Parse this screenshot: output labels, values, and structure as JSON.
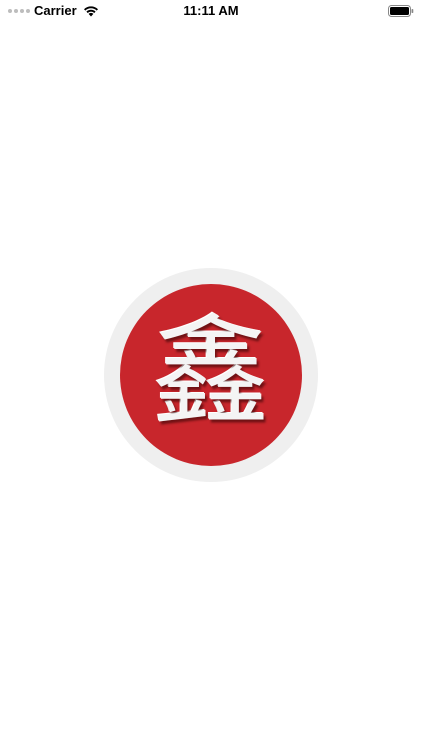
{
  "status_bar": {
    "carrier": "Carrier",
    "time": "11:11 AM",
    "icons": [
      "signal-icon",
      "wifi-icon",
      "battery-icon"
    ]
  },
  "splash": {
    "logo_glyph": "鑫",
    "colors": {
      "logo_red": "#c8262c",
      "ring_gray": "#efefef",
      "background": "#ffffff"
    }
  }
}
